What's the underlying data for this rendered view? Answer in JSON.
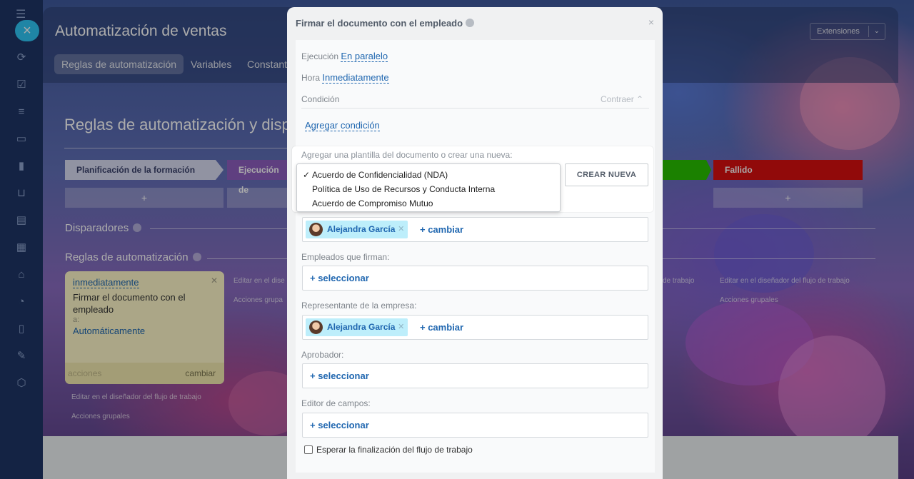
{
  "app": {
    "title": "Automatización de ventas",
    "extensions_label": "Extensiones",
    "tabs": [
      {
        "label": "Reglas de automatización"
      },
      {
        "label": "Variables"
      },
      {
        "label": "Constant"
      }
    ]
  },
  "content": {
    "title": "Reglas de automatización y disp",
    "stages": [
      {
        "label": "Planificación de la formación",
        "color": "#d9dcf2"
      },
      {
        "label": "Ejecución de",
        "color": "#8e5fbf"
      },
      {
        "label": "Fallido",
        "color": "#d90f0f"
      }
    ],
    "add_symbol": "+",
    "triggers_label": "Disparadores",
    "rules_label": "Reglas de automatización",
    "rule_card": {
      "when": "inmediatamente",
      "name": "Firmar el documento con el empleado",
      "to": "a:",
      "auto": "Automáticamente",
      "actions": "acciones",
      "change": "cambiar"
    },
    "edit_designer": "Editar en el diseñador del flujo de trabajo",
    "group_actions": "Acciones grupales",
    "edit_short": "Editar en el dise",
    "group_short": "Acciones grupa",
    "right_edit_a": "de trabajo",
    "right_edit_b": "Editar en el diseñador del flujo de trabajo",
    "right_group": "Acciones grupales"
  },
  "modal": {
    "title": "Firmar el documento con el empleado",
    "close": "×",
    "execution_label": "Ejecución",
    "execution_value": "En paralelo",
    "time_label": "Hora",
    "time_value": "Inmediatamente",
    "condition_label": "Condición",
    "collapse_label": "Contraer",
    "add_condition": "Agregar condición",
    "template_label": "Agregar una plantilla del documento o crear una nueva:",
    "template_options": [
      "Acuerdo de Confidencialidad (NDA)",
      "Política de Uso de Recursos y Conducta Interna",
      "Acuerdo de Compromiso Mutuo"
    ],
    "selected_mark": "✓",
    "create_new": "CREAR NUEVA",
    "signer_chip": "Alejandra García",
    "change": "+ cambiar",
    "employees_label": "Empleados que firman:",
    "select": "+ seleccionar",
    "company_rep_label": "Representante de la empresa:",
    "company_rep_chip": "Alejandra García",
    "approver_label": "Aprobador:",
    "fields_editor_label": "Editor de campos:",
    "wait_label": "Esperar la finalización del flujo de trabajo"
  }
}
